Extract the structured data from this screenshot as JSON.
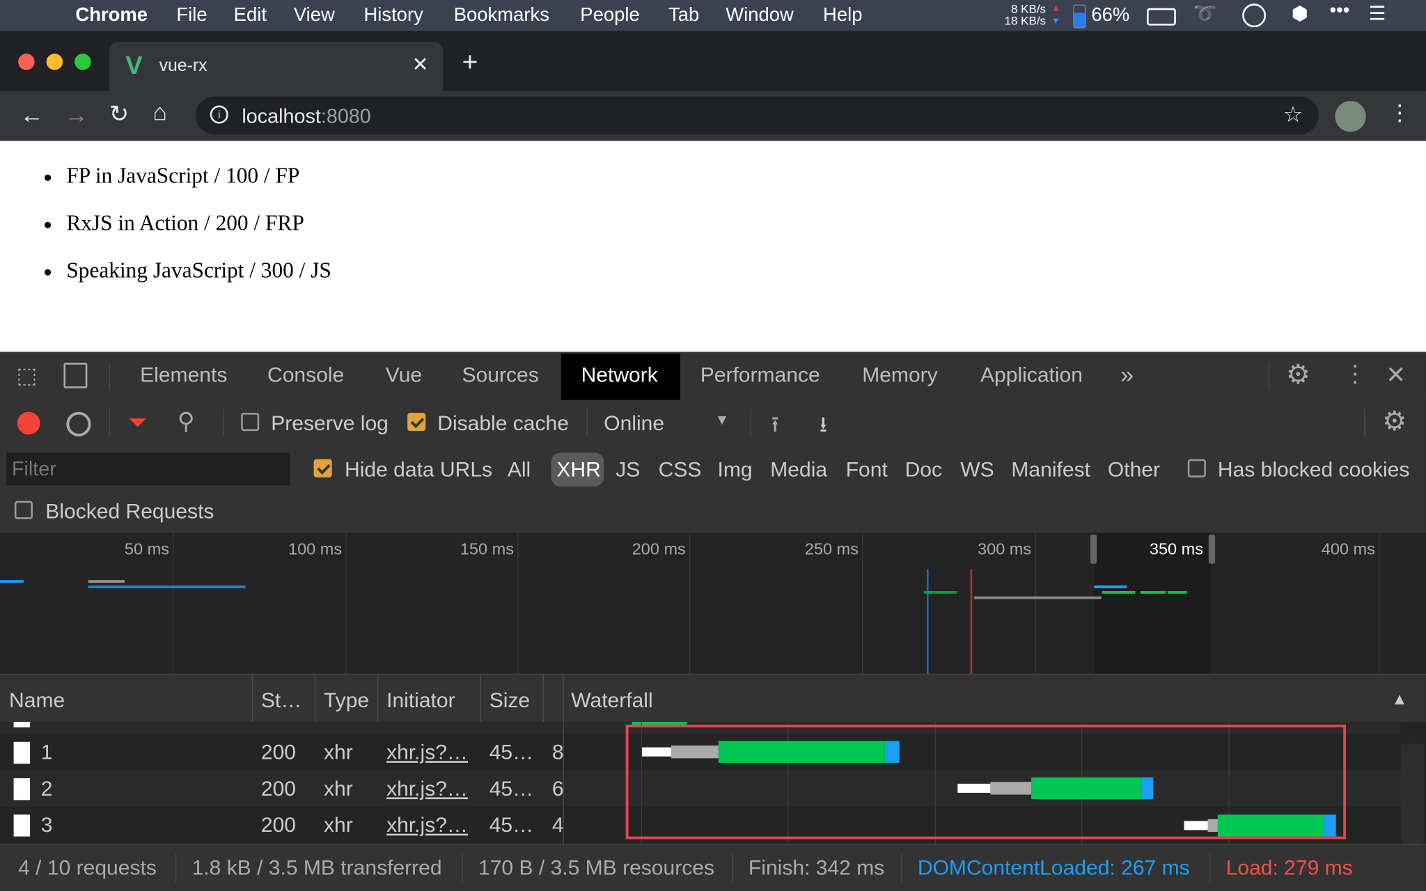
{
  "menubar": {
    "app": "Chrome",
    "items": [
      "File",
      "Edit",
      "View",
      "History",
      "Bookmarks",
      "People",
      "Tab",
      "Window",
      "Help"
    ],
    "net_up": "8 KB/s",
    "net_down": "18 KB/s",
    "battery": "66%"
  },
  "browser": {
    "tab_title": "vue-rx",
    "url_host": "localhost",
    "url_port": ":8080"
  },
  "page": {
    "items": [
      "FP in JavaScript / 100 / FP",
      "RxJS in Action / 200 / FRP",
      "Speaking JavaScript / 300 / JS"
    ]
  },
  "devtools": {
    "tabs": [
      "Elements",
      "Console",
      "Vue",
      "Sources",
      "Network",
      "Performance",
      "Memory",
      "Application"
    ],
    "active_tab": "Network",
    "toolbar": {
      "preserve_log": "Preserve log",
      "preserve_log_checked": false,
      "disable_cache": "Disable cache",
      "disable_cache_checked": true,
      "throttle": "Online"
    },
    "filter": {
      "placeholder": "Filter",
      "hide_data_urls": "Hide data URLs",
      "hide_data_urls_checked": true,
      "types": [
        "All",
        "XHR",
        "JS",
        "CSS",
        "Img",
        "Media",
        "Font",
        "Doc",
        "WS",
        "Manifest",
        "Other"
      ],
      "active_type": "XHR",
      "has_blocked_cookies": "Has blocked cookies",
      "blocked_requests": "Blocked Requests"
    },
    "overview_ticks": [
      "50 ms",
      "100 ms",
      "150 ms",
      "200 ms",
      "250 ms",
      "300 ms",
      "350 ms",
      "400 ms"
    ],
    "columns": [
      "Name",
      "St…",
      "Type",
      "Initiator",
      "Size",
      "Waterfall"
    ],
    "rows": [
      {
        "name": "1",
        "status": "200",
        "type": "xhr",
        "initiator": "xhr.js?…",
        "size": "45…",
        "time": "8"
      },
      {
        "name": "2",
        "status": "200",
        "type": "xhr",
        "initiator": "xhr.js?…",
        "size": "45…",
        "time": "6"
      },
      {
        "name": "3",
        "status": "200",
        "type": "xhr",
        "initiator": "xhr.js?…",
        "size": "45…",
        "time": "4"
      }
    ],
    "status": {
      "requests": "4 / 10 requests",
      "transferred": "1.8 kB / 3.5 MB transferred",
      "resources": "170 B / 3.5 MB resources",
      "finish": "Finish: 342 ms",
      "dom": "DOMContentLoaded: 267 ms",
      "load": "Load: 279 ms"
    },
    "colors": {
      "dom": "#1a9ff5",
      "load": "#f0504a",
      "highlight": "#e8434a",
      "green": "#00c853",
      "blue": "#1a9ff5"
    }
  }
}
